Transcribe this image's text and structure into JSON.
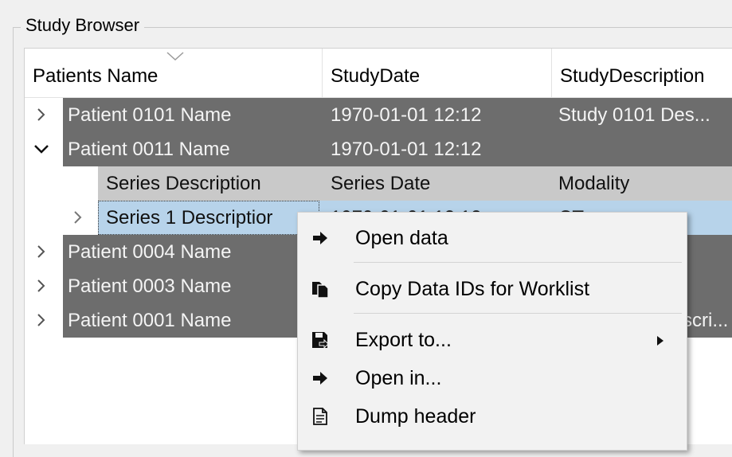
{
  "groupbox": {
    "title": "Study Browser"
  },
  "columns": [
    "Patients Name",
    "StudyDate",
    "StudyDescription"
  ],
  "rows": [
    {
      "name": "Patient 0101 Name",
      "date": "1970-01-01 12:12",
      "desc": "Study 0101 Des...",
      "expanded": false
    },
    {
      "name": "Patient 0011 Name",
      "date": "1970-01-01 12:12",
      "desc": "",
      "expanded": true
    }
  ],
  "series_header": {
    "col1": "Series Description",
    "col2": "Series Date",
    "col3": "Modality"
  },
  "series_row": {
    "name": "Series 1 Descriptior",
    "date": "1970-01-01 12:12",
    "modality": "CT"
  },
  "more_rows": [
    {
      "name": "Patient 0004 Name",
      "date": "",
      "desc": ""
    },
    {
      "name": "Patient 0003 Name",
      "date": "",
      "desc": ""
    },
    {
      "name": "Patient 0001 Name",
      "date": "",
      "desc": "...scri..."
    }
  ],
  "context_menu": {
    "items": [
      {
        "label": "Open data",
        "icon": "arrow-right-icon"
      },
      {
        "label": "Copy Data IDs for Worklist",
        "icon": "copy-documents-icon"
      },
      {
        "label": "Export to...",
        "icon": "save-export-icon",
        "has_submenu": true
      },
      {
        "label": "Open in...",
        "icon": "arrow-right-icon"
      },
      {
        "label": "Dump header",
        "icon": "document-icon"
      }
    ]
  },
  "colors": {
    "row_band": "#6d6d6d",
    "sub_header": "#c9c9c9",
    "selection": "#b7d3ea"
  }
}
